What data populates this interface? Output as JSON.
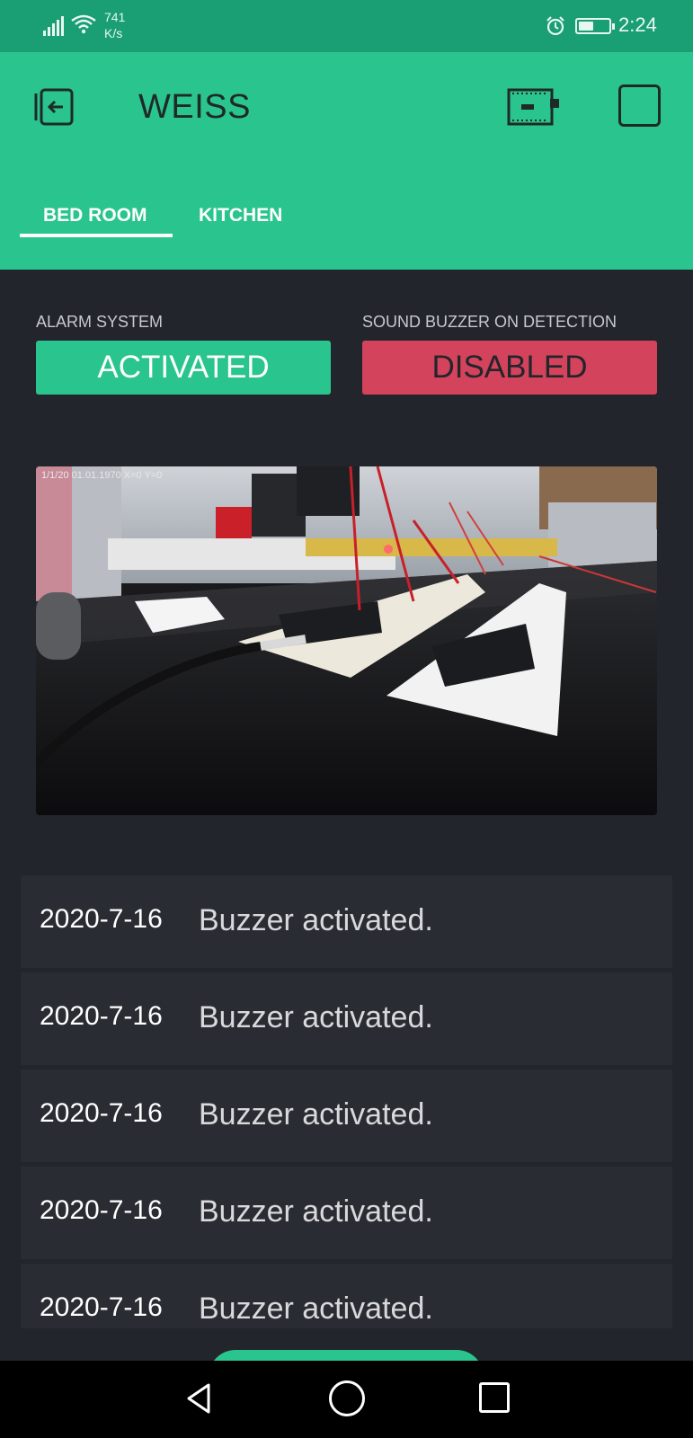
{
  "status_bar": {
    "net_speed_value": "741",
    "net_speed_unit": "K/s",
    "time": "2:24",
    "battery_level": 0.5,
    "icons": [
      "signal-icon",
      "wifi-icon",
      "alarm-clock-icon",
      "battery-icon"
    ]
  },
  "header": {
    "title": "WEISS",
    "icons": [
      "exit-icon",
      "device-board-icon",
      "square-icon"
    ],
    "tabs": [
      {
        "label": "BED ROOM",
        "active": true
      },
      {
        "label": "KITCHEN",
        "active": false
      }
    ]
  },
  "controls": {
    "alarm": {
      "label": "ALARM SYSTEM",
      "state": "ACTIVATED",
      "color": "#2ac48f"
    },
    "buzzer": {
      "label": "SOUND BUZZER ON DETECTION",
      "state": "DISABLED",
      "color": "#d3435b"
    }
  },
  "video": {
    "osd": "1/1/20 01.01.1970 X=0 Y=0"
  },
  "log": [
    {
      "date": "2020-7-16",
      "message": "Buzzer activated."
    },
    {
      "date": "2020-7-16",
      "message": "Buzzer activated."
    },
    {
      "date": "2020-7-16",
      "message": "Buzzer activated."
    },
    {
      "date": "2020-7-16",
      "message": "Buzzer activated."
    },
    {
      "date": "2020-7-16",
      "message": "Buzzer activated."
    }
  ],
  "navigation": {
    "icons": [
      "back-icon",
      "home-icon",
      "recent-apps-icon"
    ]
  },
  "colors": {
    "accent": "#2ac48f",
    "status_bar": "#1a9e73",
    "background": "#23252c",
    "danger": "#d3435b"
  }
}
